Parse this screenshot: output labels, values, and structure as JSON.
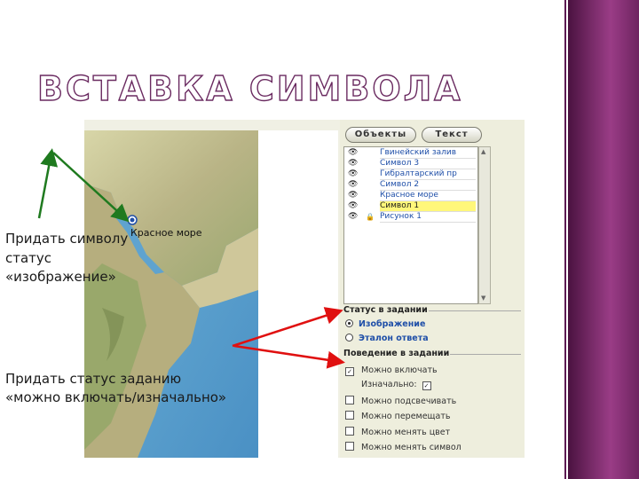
{
  "slide": {
    "title": "ВСТАВКА СИМВОЛА"
  },
  "map": {
    "label": "Красное море"
  },
  "panel": {
    "tabs": [
      "Объекты",
      "Текст"
    ],
    "objects": [
      {
        "name": "Гвинейский залив",
        "locked": false,
        "selected": false
      },
      {
        "name": "Символ 3",
        "locked": false,
        "selected": false
      },
      {
        "name": "Гибралтарский пр",
        "locked": false,
        "selected": false
      },
      {
        "name": "Символ 2",
        "locked": false,
        "selected": false
      },
      {
        "name": "Красное море",
        "locked": false,
        "selected": false
      },
      {
        "name": "Символ 1",
        "locked": false,
        "selected": true
      },
      {
        "name": "Рисунок 1",
        "locked": true,
        "selected": false
      }
    ],
    "status_header": "Статус в задании",
    "status_options": [
      {
        "label": "Изображение",
        "selected": true
      },
      {
        "label": "Эталон ответа",
        "selected": false
      }
    ],
    "behavior_header": "Поведение в задании",
    "behavior_options": [
      {
        "label": "Можно включать",
        "checked": true
      },
      {
        "label": "Изначально:",
        "checked": true
      },
      {
        "label": "Можно подсвечивать",
        "checked": false
      },
      {
        "label": "Можно перемещать",
        "checked": false
      },
      {
        "label": "Можно менять цвет",
        "checked": false
      },
      {
        "label": "Можно менять символ",
        "checked": false
      }
    ]
  },
  "notes": {
    "note1": [
      "Придать символу",
      "статус",
      "«изображение»"
    ],
    "note2": [
      "Придать статус заданию",
      "«можно включать/изначально»"
    ]
  },
  "colors": {
    "accent": "#7a2c6a",
    "arrow_green": "#1f7a1f",
    "arrow_red": "#e01010",
    "selection": "#fff77a"
  },
  "icons": {
    "visibility": "eye-icon",
    "lock": "lock-icon"
  }
}
